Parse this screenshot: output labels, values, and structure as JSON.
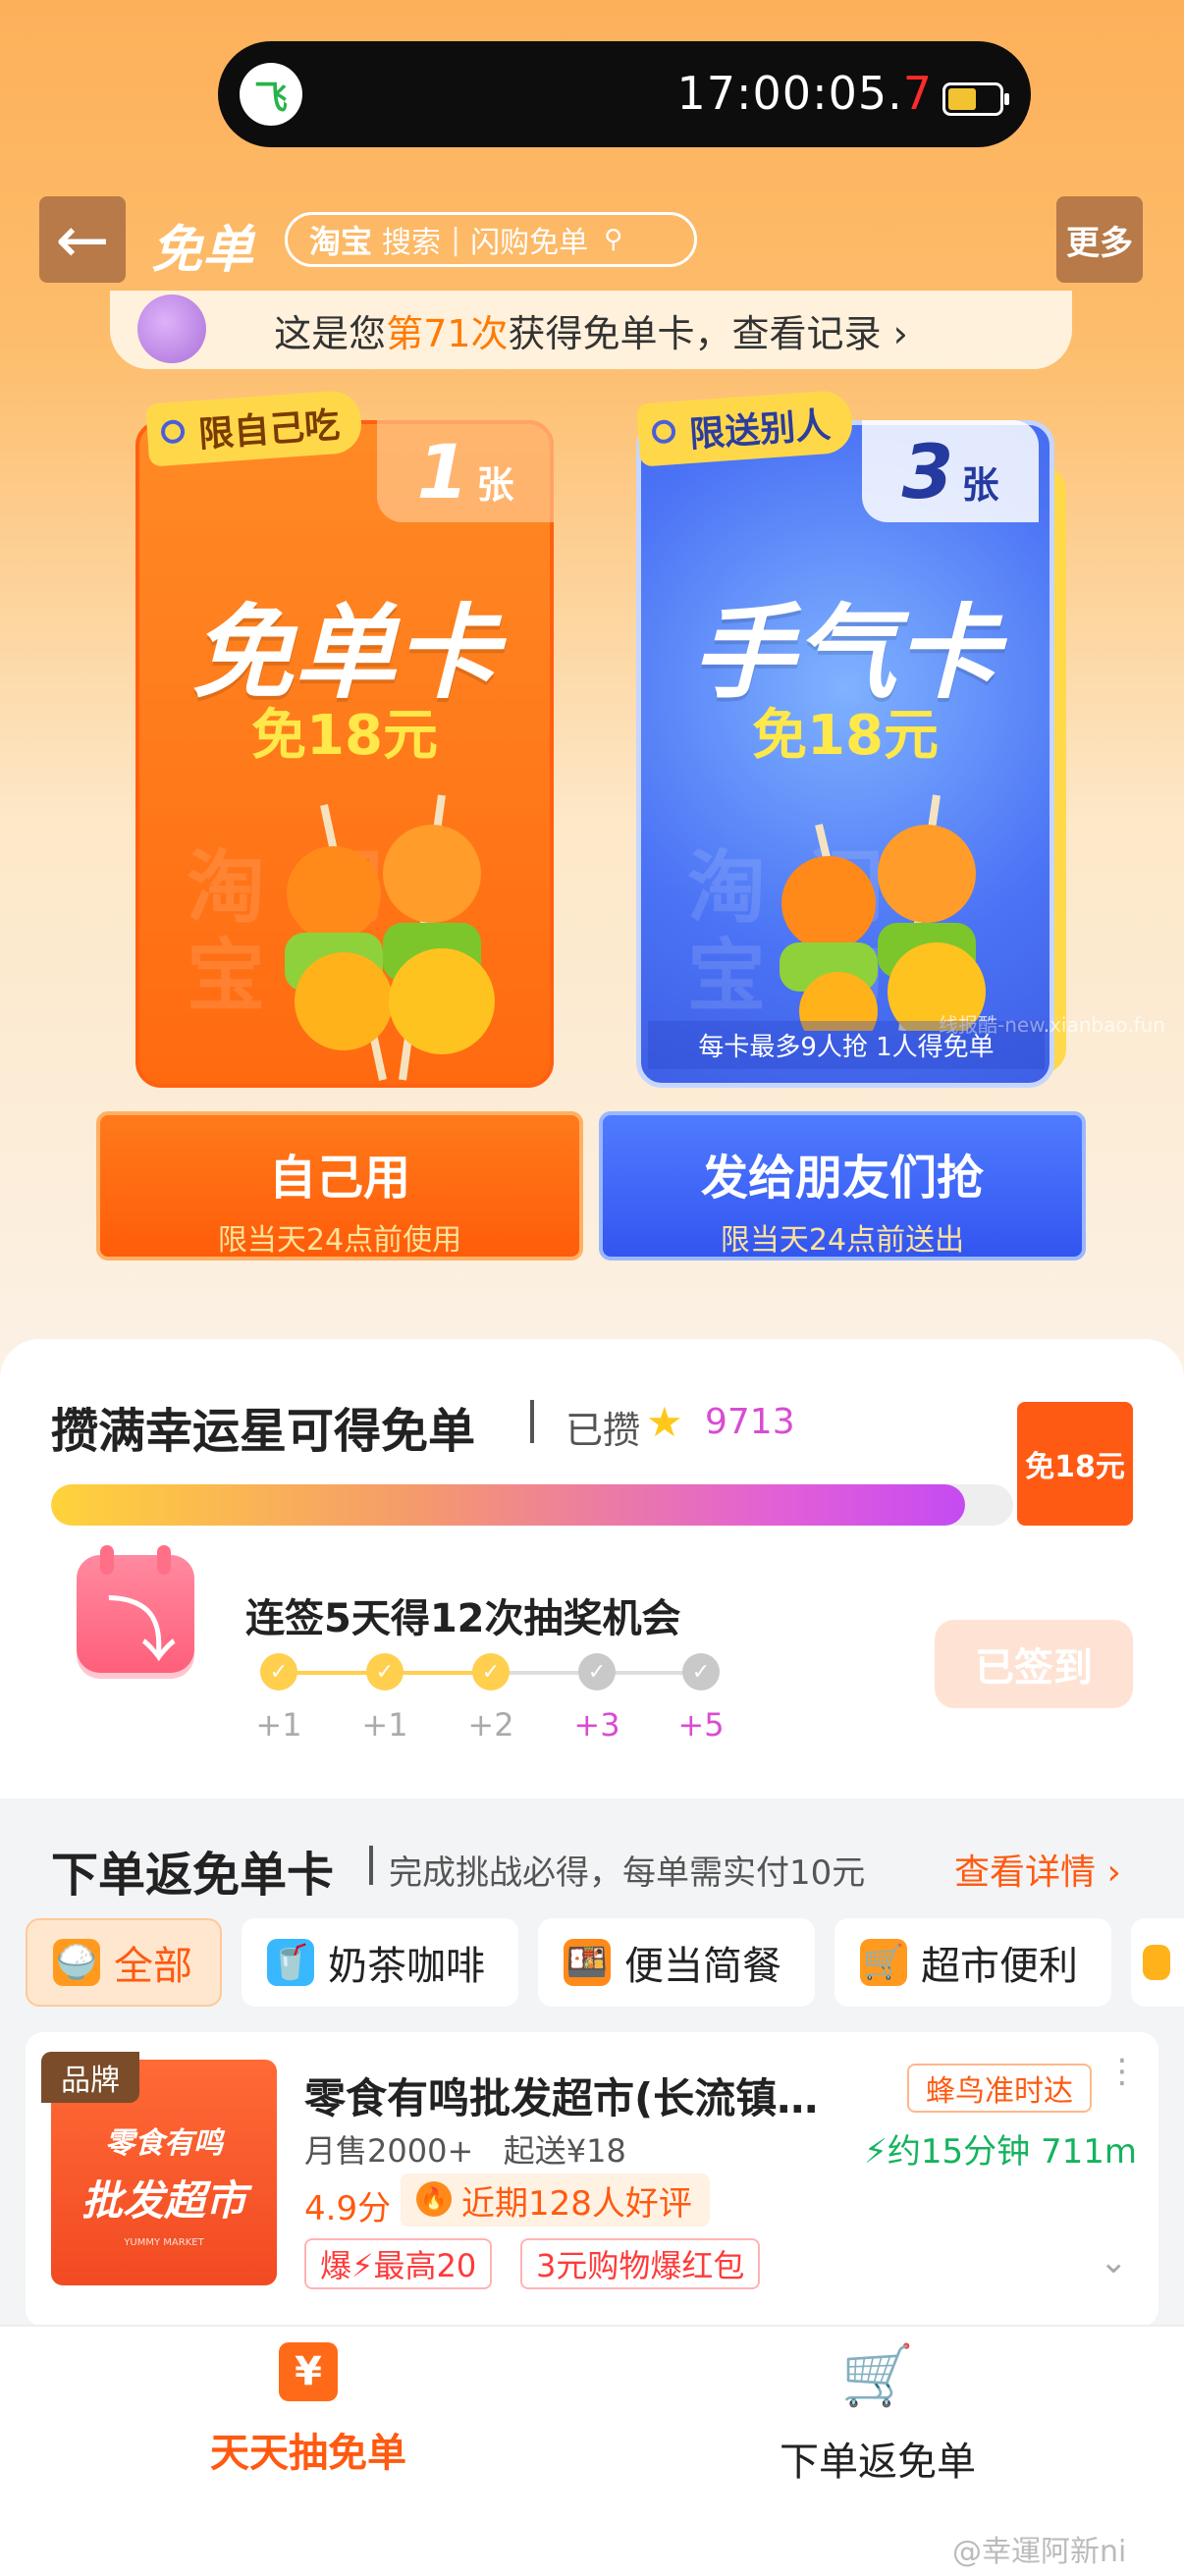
{
  "status": {
    "logo": "飞",
    "time_main": "17:00:05.",
    "time_red": "7"
  },
  "header": {
    "back_icon": "←",
    "title": "免单",
    "brand": "淘宝",
    "search_label": "搜索",
    "search_sep": "|",
    "search_text": "闪购免单",
    "more": "更多"
  },
  "record": {
    "prefix": "这是您",
    "highlight": "第71次",
    "suffix": "获得免单卡，查看记录 ›"
  },
  "cards": {
    "left": {
      "tag": "限自己吃",
      "count": "1",
      "unit": "张",
      "name": "免单卡",
      "value": "免18元",
      "watermark1": "淘闪",
      "watermark2": "宝购"
    },
    "right": {
      "tag": "限送别人",
      "count": "3",
      "unit": "张",
      "name": "手气卡",
      "value": "免18元",
      "watermark1": "淘闪",
      "watermark2": "宝购",
      "note": "每卡最多9人抢 1人得免单",
      "site": "线报酷-new.xianbao.fun"
    }
  },
  "actions": {
    "self": {
      "label": "自己用",
      "sub": "限当天24点前使用"
    },
    "send": {
      "label": "发给朋友们抢",
      "sub": "限当天24点前送出"
    }
  },
  "lucky": {
    "title": "攒满幸运星可得免单",
    "saved": "已攒",
    "star": "★",
    "count": "9713",
    "progress": 0.95,
    "ticket": "免18元"
  },
  "signin": {
    "title": "连签5天得12次抽奖机会",
    "check": "✓",
    "days": [
      {
        "label": "+1",
        "done": true
      },
      {
        "label": "+1",
        "done": true
      },
      {
        "label": "+2",
        "done": true
      },
      {
        "label": "+3",
        "done": false
      },
      {
        "label": "+5",
        "done": false
      }
    ],
    "button": "已签到"
  },
  "order": {
    "title": "下单返免单卡",
    "sub": "完成挑战必得，每单需实付10元",
    "detail": "查看详情 ›",
    "categories": [
      "全部",
      "奶茶咖啡",
      "便当简餐",
      "超市便利"
    ],
    "cat_icons": [
      "🍚",
      "🥤",
      "🍱",
      "🛒"
    ]
  },
  "shop": {
    "badge": "品牌",
    "img_line1": "零食有鸣",
    "img_line2": "批发超市",
    "img_line3": "YUMMY MARKET",
    "name": "零食有鸣批发超市(长流镇…",
    "delivery": "蜂鸟准时达",
    "more": "⋮",
    "monthly": "月售2000+",
    "min_order": "起送¥18",
    "time": "⚡约15分钟  711m",
    "rating": "4.9分",
    "fire": "🔥",
    "review": "近期128人好评",
    "promo1": "爆⚡最高20",
    "promo2": "3元购物爆红包",
    "expand": "⌄"
  },
  "nav": {
    "left": "天天抽免单",
    "left_icon": "¥",
    "right": "下单返免单",
    "right_icon": "🛒"
  },
  "watermark": "@幸運阿新ni"
}
